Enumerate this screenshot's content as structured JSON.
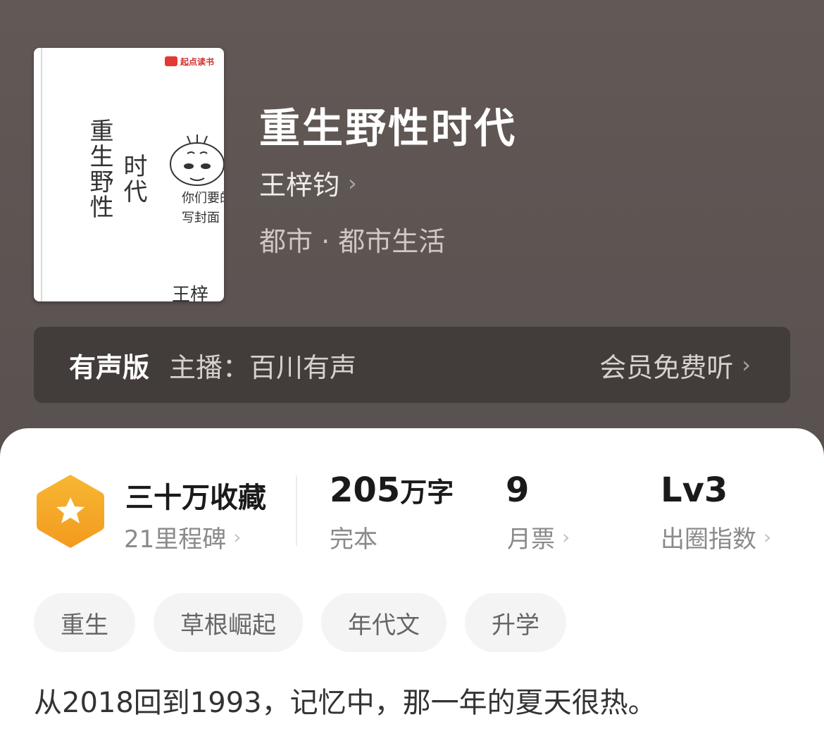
{
  "cover": {
    "logo_text": "起点读书",
    "handwritten_title_col1": "重生野性",
    "handwritten_title_col2": "时代",
    "handwritten_note": "你们要的手写封面",
    "handwritten_author": "王梓钧"
  },
  "book": {
    "title": "重生野性时代",
    "author": "王梓钧",
    "category": "都市 · 都市生活"
  },
  "audio": {
    "label": "有声版",
    "host": "主播：百川有声",
    "action": "会员免费听"
  },
  "stats": {
    "favorites": "三十万收藏",
    "milestone": "21里程碑",
    "word_count_num": "205",
    "word_count_unit": "万字",
    "status": "完本",
    "monthly_tickets": "9",
    "monthly_label": "月票",
    "level": "Lv3",
    "level_label": "出圈指数"
  },
  "tags": [
    "重生",
    "草根崛起",
    "年代文",
    "升学"
  ],
  "description": "从2018回到1993，记忆中，那一年的夏天很热。",
  "colors": {
    "header_bg": "#5f5754",
    "badge_orange": "#f5a623"
  }
}
